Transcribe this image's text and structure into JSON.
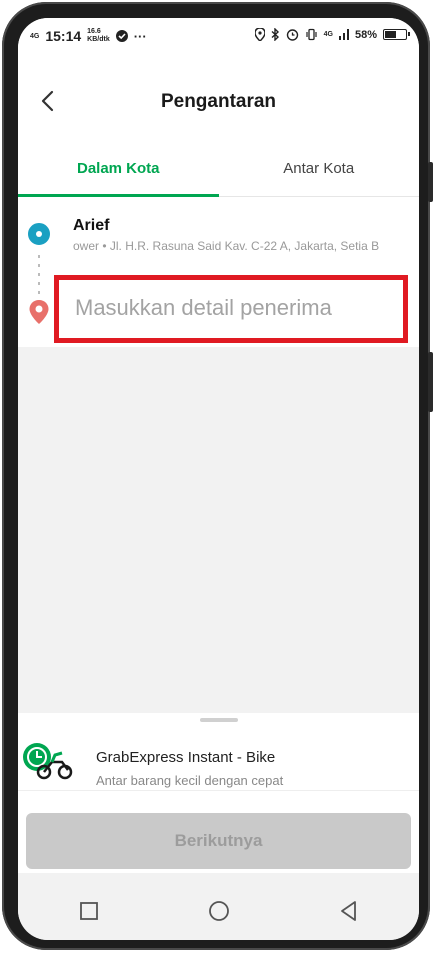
{
  "status_bar": {
    "network": "4G",
    "time": "15:14",
    "speed_value": "16.6",
    "speed_unit": "KB/dtk",
    "more": "···",
    "data_type": "4G",
    "battery_percent": "58%",
    "battery_level": 0.58
  },
  "header": {
    "title": "Pengantaran"
  },
  "tabs": [
    {
      "label": "Dalam Kota",
      "active": true
    },
    {
      "label": "Antar Kota",
      "active": false
    }
  ],
  "route": {
    "sender_name": "Arief",
    "sender_address": "ower • Jl. H.R. Rasuna Said Kav. C-22 A, Jakarta, Setia B",
    "recipient_placeholder": "Masukkan detail penerima"
  },
  "service": {
    "name": "GrabExpress Instant - Bike",
    "description": "Antar barang kecil dengan cepat"
  },
  "next_button": {
    "label": "Berikutnya"
  },
  "colors": {
    "accent": "#00a651",
    "highlight": "#e01a22",
    "origin_dot": "#1aa0c2",
    "pin": "#e8706a",
    "disabled_button": "#c9c9c9"
  },
  "icons": {
    "back": "arrow-left",
    "origin": "circle-dot",
    "destination": "location-pin",
    "service": "motorbike-delivery",
    "nav_recent": "square",
    "nav_home": "circle",
    "nav_back": "triangle-left"
  }
}
